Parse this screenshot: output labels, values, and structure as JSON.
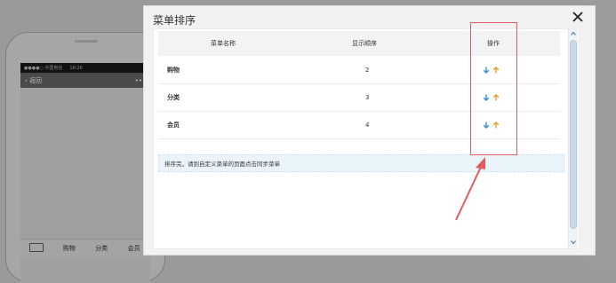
{
  "phone": {
    "status_carrier": "●●●●○ 中国电信",
    "status_time": "16:26",
    "back_label": "返回",
    "more_label": "•••",
    "bottom_items": [
      "购物",
      "分类",
      "会员"
    ]
  },
  "modal": {
    "title": "菜单排序",
    "columns": [
      "菜单名称",
      "显示顺序",
      "操作"
    ],
    "rows": [
      {
        "name": "购物",
        "order": "2"
      },
      {
        "name": "分类",
        "order": "3"
      },
      {
        "name": "会员",
        "order": "4"
      }
    ],
    "tip": "排序完，请到自定义菜单的页面点击同步菜单"
  },
  "colors": {
    "down_arrow": "#3a8fd8",
    "up_arrow": "#e0a12c",
    "annotation": "#e25b5b"
  },
  "icons": {
    "close": "close-icon",
    "down": "arrow-down-icon",
    "up": "arrow-up-icon",
    "keyboard": "keyboard-icon"
  }
}
